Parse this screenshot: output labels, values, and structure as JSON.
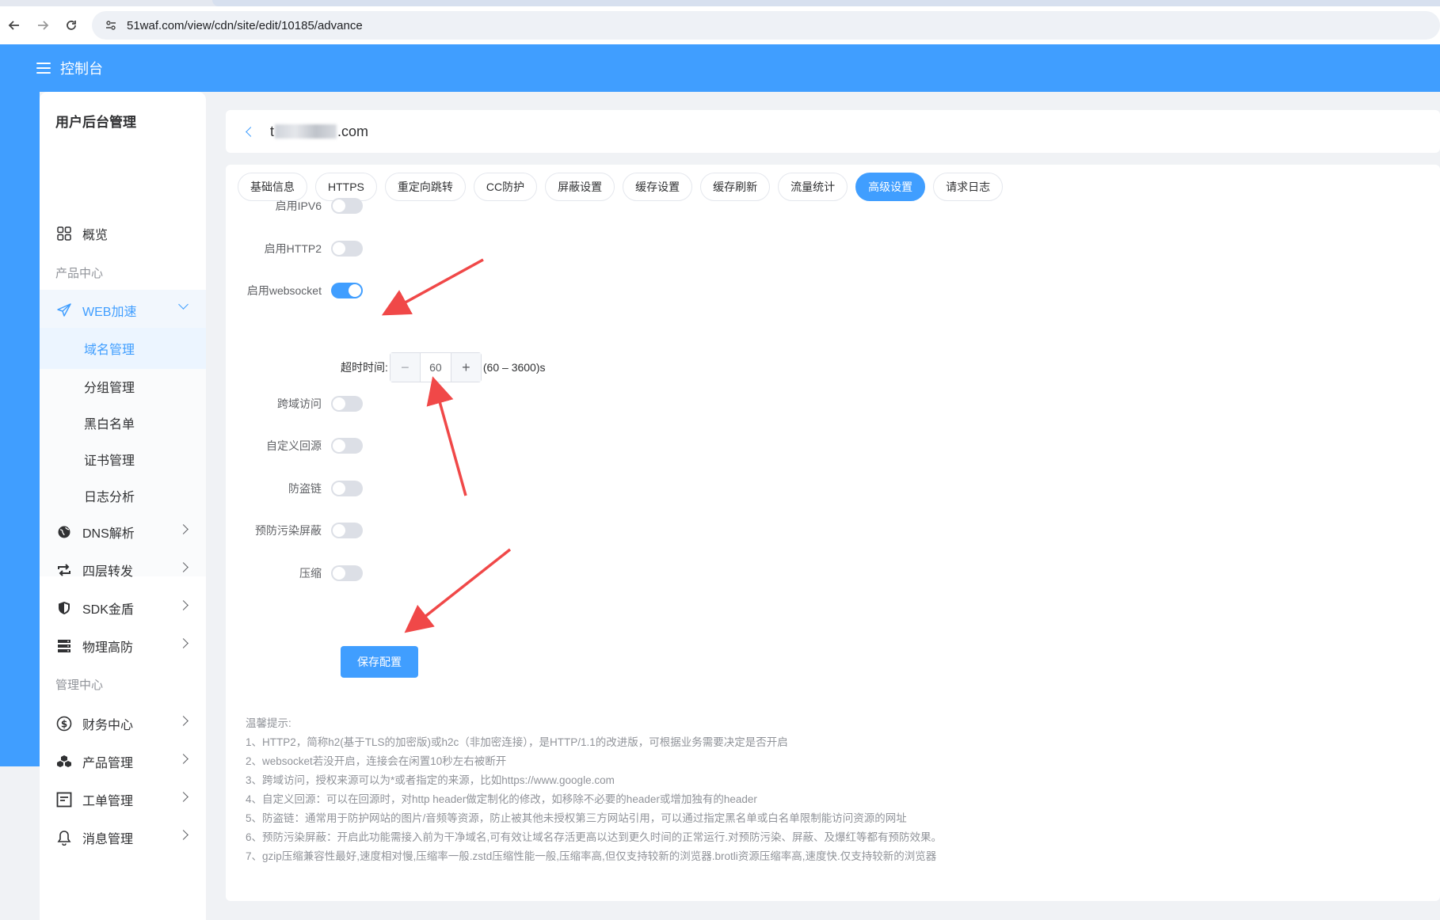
{
  "browser": {
    "url": "51waf.com/view/cdn/site/edit/10185/advance"
  },
  "header": {
    "title": "控制台"
  },
  "sidebar": {
    "title": "用户后台管理",
    "overview": "概览",
    "group_product": "产品中心",
    "web_accel": "WEB加速",
    "sub_items": [
      "域名管理",
      "分组管理",
      "黑白名单",
      "证书管理",
      "日志分析"
    ],
    "dns": "DNS解析",
    "layer4": "四层转发",
    "sdk": "SDK金盾",
    "physical": "物理高防",
    "group_manage": "管理中心",
    "finance": "财务中心",
    "product_manage": "产品管理",
    "ticket": "工单管理",
    "message": "消息管理"
  },
  "domain": {
    "prefix": "t",
    "suffix": ".com"
  },
  "tabs": [
    "基础信息",
    "HTTPS",
    "重定向跳转",
    "CC防护",
    "屏蔽设置",
    "缓存设置",
    "缓存刷新",
    "流量统计",
    "高级设置",
    "请求日志"
  ],
  "active_tab": "高级设置",
  "form": {
    "ipv6": "启用IPV6",
    "http2": "启用HTTP2",
    "websocket": "启用websocket",
    "timeout_label": "超时时间:",
    "timeout_value": "60",
    "timeout_range": "(60 – 3600)s",
    "cors": "跨域访问",
    "custom_origin": "自定义回源",
    "hotlink": "防盗链",
    "anti_pollution": "预防污染屏蔽",
    "compress": "压缩",
    "save": "保存配置",
    "websocket_enabled": true
  },
  "tips": {
    "title": "温馨提示:",
    "lines": [
      "1、HTTP2，简称h2(基于TLS的加密版)或h2c（非加密连接），是HTTP/1.1的改进版，可根据业务需要决定是否开启",
      "2、websocket若没开启，连接会在闲置10秒左右被断开",
      "3、跨域访问，授权来源可以为*或者指定的来源，比如https://www.google.com",
      "4、自定义回源：可以在回源时，对http header做定制化的修改，如移除不必要的header或增加独有的header",
      "5、防盗链：通常用于防护网站的图片/音频等资源，防止被其他未授权第三方网站引用，可以通过指定黑名单或白名单限制能访问资源的网址",
      "6、预防污染屏蔽：开启此功能需接入前为干净域名,可有效让域名存活更高以达到更久时间的正常运行.对预防污染、屏蔽、及爆红等都有预防效果。",
      "7、gzip压缩兼容性最好,速度相对慢,压缩率一般.zstd压缩性能一般,压缩率高,但仅支持较新的浏览器.brotli资源压缩率高,速度快.仅支持较新的浏览器"
    ]
  },
  "colors": {
    "primary": "#409eff",
    "annotation_arrow": "#f04848"
  }
}
